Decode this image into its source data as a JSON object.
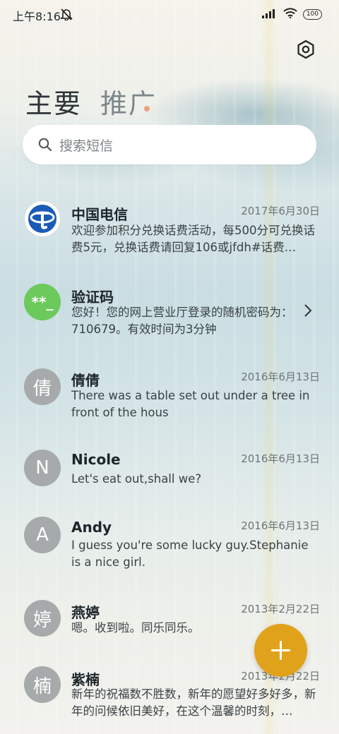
{
  "status_bar": {
    "time": "上午8:16",
    "battery": "100"
  },
  "tabs": [
    {
      "label": "主要"
    },
    {
      "label": "推广"
    }
  ],
  "search": {
    "placeholder": "搜索短信"
  },
  "messages": [
    {
      "avatar_text": "",
      "sender": "中国电信",
      "date": "2017年6月30日",
      "preview": "欢迎参加积分兑换话费活动，每500分可兑换话费5元，兑换话费请回复106或jfdh#话费…"
    },
    {
      "avatar_text": "**_",
      "sender": "验证码",
      "date": "",
      "preview": "您好！您的网上营业厅登录的随机密码为：710679。有效时间为3分钟"
    },
    {
      "avatar_text": "倩",
      "sender": "倩倩",
      "date": "2016年6月13日",
      "preview": "There was a table set out under a tree in front of the hous"
    },
    {
      "avatar_text": "N",
      "sender": "Nicole",
      "date": "2016年6月13日",
      "preview": "Let's eat out,shall we?"
    },
    {
      "avatar_text": "A",
      "sender": "Andy",
      "date": "2016年6月13日",
      "preview": "I guess you're some lucky guy.Stephanie is a nice girl."
    },
    {
      "avatar_text": "婷",
      "sender": "燕婷",
      "date": "2013年2月22日",
      "preview": "嗯。收到啦。同乐同乐。"
    },
    {
      "avatar_text": "楠",
      "sender": "紫楠",
      "date": "2013年2月22日",
      "preview": "新年的祝福数不胜数，新年的愿望好多好多，新年的问候依旧美好，在这个温馨的时刻，…"
    }
  ],
  "colors": {
    "fab": "#e1a21b",
    "verify_avatar": "#6cc95b",
    "telecom_blue": "#1a5bb5"
  },
  "icons": [
    "mute-icon",
    "signal-icon",
    "wifi-icon",
    "battery-icon",
    "settings-icon",
    "search-icon",
    "chevron-right-icon",
    "plus-icon"
  ]
}
